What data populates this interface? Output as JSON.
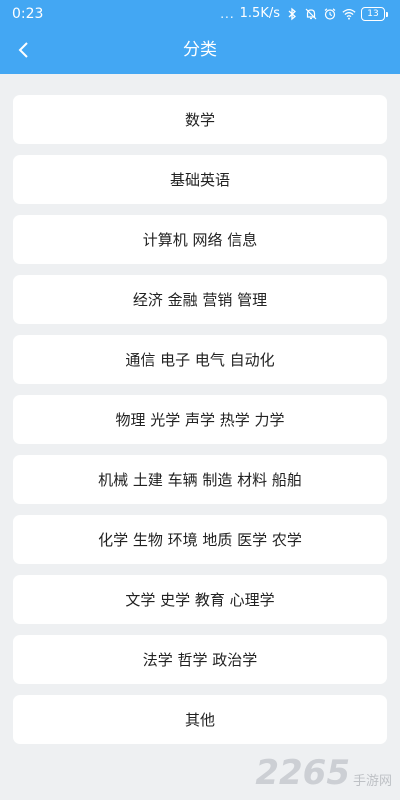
{
  "status_bar": {
    "time": "0:23",
    "signal_dots": "...",
    "net_speed": "1.5K/s",
    "battery": "13"
  },
  "header": {
    "title": "分类",
    "back_icon": "chevron-left-icon",
    "background_color": "#43a7f3"
  },
  "categories": [
    "数学",
    "基础英语",
    "计算机 网络 信息",
    "经济 金融 营销 管理",
    "通信 电子 电气  自动化",
    "物理 光学 声学 热学 力学",
    "机械 土建 车辆 制造 材料 船舶",
    "化学 生物 环境 地质 医学 农学",
    "文学 史学 教育 心理学",
    "法学  哲学 政治学",
    "其他"
  ],
  "watermark": {
    "logo_text": "2265",
    "site_text": "手游网"
  }
}
